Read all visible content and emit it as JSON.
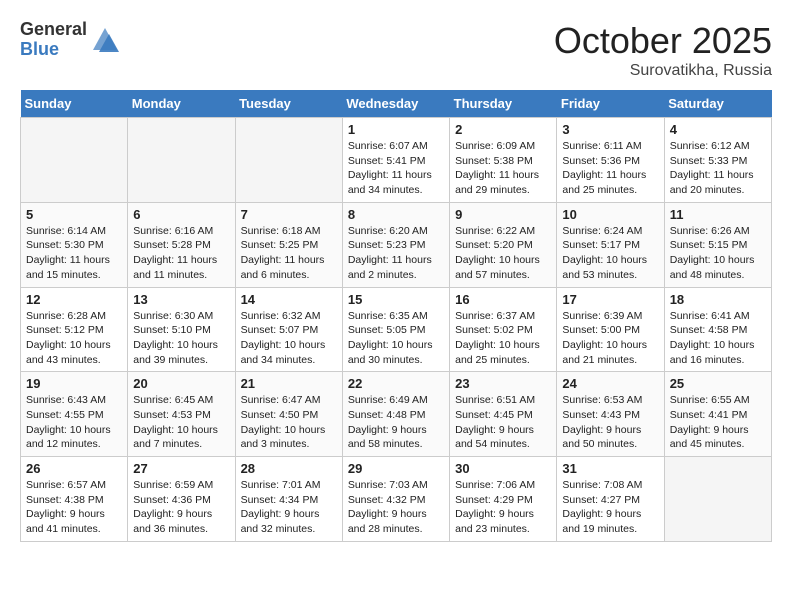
{
  "logo": {
    "general": "General",
    "blue": "Blue"
  },
  "title": "October 2025",
  "subtitle": "Surovatikha, Russia",
  "weekdays": [
    "Sunday",
    "Monday",
    "Tuesday",
    "Wednesday",
    "Thursday",
    "Friday",
    "Saturday"
  ],
  "weeks": [
    [
      {
        "day": "",
        "empty": true
      },
      {
        "day": "",
        "empty": true
      },
      {
        "day": "",
        "empty": true
      },
      {
        "day": "1",
        "sunrise": "6:07 AM",
        "sunset": "5:41 PM",
        "daylight": "11 hours and 34 minutes."
      },
      {
        "day": "2",
        "sunrise": "6:09 AM",
        "sunset": "5:38 PM",
        "daylight": "11 hours and 29 minutes."
      },
      {
        "day": "3",
        "sunrise": "6:11 AM",
        "sunset": "5:36 PM",
        "daylight": "11 hours and 25 minutes."
      },
      {
        "day": "4",
        "sunrise": "6:12 AM",
        "sunset": "5:33 PM",
        "daylight": "11 hours and 20 minutes."
      }
    ],
    [
      {
        "day": "5",
        "sunrise": "6:14 AM",
        "sunset": "5:30 PM",
        "daylight": "11 hours and 15 minutes."
      },
      {
        "day": "6",
        "sunrise": "6:16 AM",
        "sunset": "5:28 PM",
        "daylight": "11 hours and 11 minutes."
      },
      {
        "day": "7",
        "sunrise": "6:18 AM",
        "sunset": "5:25 PM",
        "daylight": "11 hours and 6 minutes."
      },
      {
        "day": "8",
        "sunrise": "6:20 AM",
        "sunset": "5:23 PM",
        "daylight": "11 hours and 2 minutes."
      },
      {
        "day": "9",
        "sunrise": "6:22 AM",
        "sunset": "5:20 PM",
        "daylight": "10 hours and 57 minutes."
      },
      {
        "day": "10",
        "sunrise": "6:24 AM",
        "sunset": "5:17 PM",
        "daylight": "10 hours and 53 minutes."
      },
      {
        "day": "11",
        "sunrise": "6:26 AM",
        "sunset": "5:15 PM",
        "daylight": "10 hours and 48 minutes."
      }
    ],
    [
      {
        "day": "12",
        "sunrise": "6:28 AM",
        "sunset": "5:12 PM",
        "daylight": "10 hours and 43 minutes."
      },
      {
        "day": "13",
        "sunrise": "6:30 AM",
        "sunset": "5:10 PM",
        "daylight": "10 hours and 39 minutes."
      },
      {
        "day": "14",
        "sunrise": "6:32 AM",
        "sunset": "5:07 PM",
        "daylight": "10 hours and 34 minutes."
      },
      {
        "day": "15",
        "sunrise": "6:35 AM",
        "sunset": "5:05 PM",
        "daylight": "10 hours and 30 minutes."
      },
      {
        "day": "16",
        "sunrise": "6:37 AM",
        "sunset": "5:02 PM",
        "daylight": "10 hours and 25 minutes."
      },
      {
        "day": "17",
        "sunrise": "6:39 AM",
        "sunset": "5:00 PM",
        "daylight": "10 hours and 21 minutes."
      },
      {
        "day": "18",
        "sunrise": "6:41 AM",
        "sunset": "4:58 PM",
        "daylight": "10 hours and 16 minutes."
      }
    ],
    [
      {
        "day": "19",
        "sunrise": "6:43 AM",
        "sunset": "4:55 PM",
        "daylight": "10 hours and 12 minutes."
      },
      {
        "day": "20",
        "sunrise": "6:45 AM",
        "sunset": "4:53 PM",
        "daylight": "10 hours and 7 minutes."
      },
      {
        "day": "21",
        "sunrise": "6:47 AM",
        "sunset": "4:50 PM",
        "daylight": "10 hours and 3 minutes."
      },
      {
        "day": "22",
        "sunrise": "6:49 AM",
        "sunset": "4:48 PM",
        "daylight": "9 hours and 58 minutes."
      },
      {
        "day": "23",
        "sunrise": "6:51 AM",
        "sunset": "4:45 PM",
        "daylight": "9 hours and 54 minutes."
      },
      {
        "day": "24",
        "sunrise": "6:53 AM",
        "sunset": "4:43 PM",
        "daylight": "9 hours and 50 minutes."
      },
      {
        "day": "25",
        "sunrise": "6:55 AM",
        "sunset": "4:41 PM",
        "daylight": "9 hours and 45 minutes."
      }
    ],
    [
      {
        "day": "26",
        "sunrise": "6:57 AM",
        "sunset": "4:38 PM",
        "daylight": "9 hours and 41 minutes."
      },
      {
        "day": "27",
        "sunrise": "6:59 AM",
        "sunset": "4:36 PM",
        "daylight": "9 hours and 36 minutes."
      },
      {
        "day": "28",
        "sunrise": "7:01 AM",
        "sunset": "4:34 PM",
        "daylight": "9 hours and 32 minutes."
      },
      {
        "day": "29",
        "sunrise": "7:03 AM",
        "sunset": "4:32 PM",
        "daylight": "9 hours and 28 minutes."
      },
      {
        "day": "30",
        "sunrise": "7:06 AM",
        "sunset": "4:29 PM",
        "daylight": "9 hours and 23 minutes."
      },
      {
        "day": "31",
        "sunrise": "7:08 AM",
        "sunset": "4:27 PM",
        "daylight": "9 hours and 19 minutes."
      },
      {
        "day": "",
        "empty": true
      }
    ]
  ]
}
